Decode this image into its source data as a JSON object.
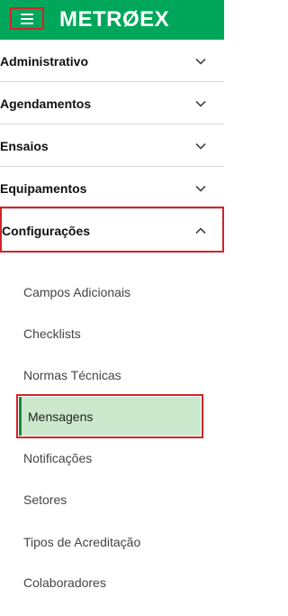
{
  "header": {
    "logo_text": "METRØEX",
    "menu_icon": "hamburger-icon",
    "bg_color": "#00a75a"
  },
  "nav": [
    {
      "label": "Administrativo",
      "state": "collapsed",
      "icon": "chevron-down-icon"
    },
    {
      "label": "Agendamentos",
      "state": "collapsed",
      "icon": "chevron-down-icon"
    },
    {
      "label": "Ensaios",
      "state": "collapsed",
      "icon": "chevron-down-icon"
    },
    {
      "label": "Equipamentos",
      "state": "collapsed",
      "icon": "chevron-down-icon"
    },
    {
      "label": "Configurações",
      "state": "expanded",
      "icon": "chevron-up-icon"
    }
  ],
  "submenu": [
    {
      "label": "Campos Adicionais"
    },
    {
      "label": "Checklists"
    },
    {
      "label": "Normas Técnicas"
    },
    {
      "label": "Mensagens",
      "active": true
    },
    {
      "label": "Notificações"
    },
    {
      "label": "Setores"
    },
    {
      "label": "Tipos de Acreditação"
    },
    {
      "label": "Colaboradores"
    }
  ],
  "colors": {
    "highlight_border": "#d2232a",
    "active_bg": "#cbe8cd"
  }
}
